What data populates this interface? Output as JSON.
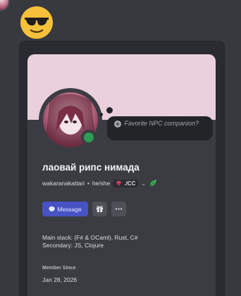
{
  "profile": {
    "display_name": "лаовай рипс нимада",
    "username": "wakaranakattari",
    "pronouns": "he/she",
    "separator": "•",
    "clan_tag": "./CC",
    "status_prompt": "Favorite NPC companion?",
    "status_icon": "plus-icon",
    "online_status_color": "#2f9c54",
    "banner_color": "#ead0da",
    "bio_lines": [
      "Main stack: (F# & OCaml), Rust, C#",
      "Secondary: JS, Clojure"
    ],
    "member_since_label": "Member Since",
    "member_since_date": "Jan 28, 2026"
  },
  "actions": {
    "message_label": "Message",
    "message_color": "#4752c4"
  },
  "icons": {
    "emoji": "sunglasses-emoji-icon",
    "clan": "gem-icon",
    "clan_chevron": "chevron-down-icon",
    "badge": "leaf-icon",
    "message": "chat-bubble-icon",
    "gift": "gift-icon",
    "more": "more-icon"
  }
}
